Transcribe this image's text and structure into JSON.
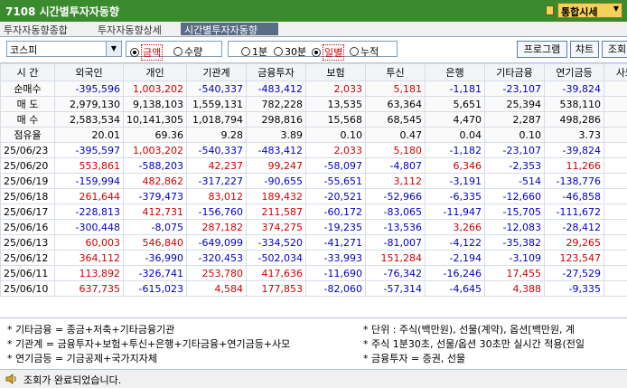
{
  "window": {
    "title": "7108 시간별투자자동향",
    "combo": "통합시세"
  },
  "tabs": [
    {
      "label": "투자자동향종합"
    },
    {
      "label": "투자자동향상세"
    },
    {
      "label": "시간별투자자동향"
    }
  ],
  "toolbar": {
    "market": "코스피",
    "unit": [
      {
        "label": "금액",
        "selected": true
      },
      {
        "label": "수량",
        "selected": false
      }
    ],
    "period": [
      {
        "label": "1분",
        "selected": false
      },
      {
        "label": "30분",
        "selected": false
      },
      {
        "label": "일별",
        "selected": true
      },
      {
        "label": "누적",
        "selected": false
      }
    ],
    "buttons": [
      "프로그램",
      "챠트",
      "조회"
    ]
  },
  "table": {
    "headers": [
      "시  간",
      "외국인",
      "개인",
      "기관계",
      "금융투자",
      "보험",
      "투신",
      "은행",
      "기타금융",
      "연기금등",
      "사모펀"
    ],
    "summary": [
      {
        "label": "순매수",
        "values": [
          "-395,596",
          "1,003,202",
          "-540,337",
          "-483,412",
          "2,033",
          "5,181",
          "-1,181",
          "-23,107",
          "-39,824",
          ""
        ]
      },
      {
        "label": "매  도",
        "values": [
          "2,979,130",
          "9,138,103",
          "1,559,131",
          "782,228",
          "13,535",
          "63,364",
          "5,651",
          "25,394",
          "538,110",
          "130"
        ]
      },
      {
        "label": "매  수",
        "values": [
          "2,583,534",
          "10,141,305",
          "1,018,794",
          "298,816",
          "15,568",
          "68,545",
          "4,470",
          "2,287",
          "498,286",
          "130"
        ]
      },
      {
        "label": "점유율",
        "values": [
          "20.01",
          "69.36",
          "9.28",
          "3.89",
          "0.10",
          "0.47",
          "0.04",
          "0.10",
          "3.73",
          ""
        ]
      }
    ],
    "rows": [
      {
        "date": "25/06/23",
        "values": [
          "-395,597",
          "1,003,202",
          "-540,337",
          "-483,412",
          "2,033",
          "5,180",
          "-1,182",
          "-23,107",
          "-39,824",
          ""
        ]
      },
      {
        "date": "25/06/20",
        "values": [
          "553,861",
          "-588,203",
          "42,237",
          "99,247",
          "-58,097",
          "-4,807",
          "6,346",
          "-2,353",
          "11,266",
          "-9"
        ]
      },
      {
        "date": "25/06/19",
        "values": [
          "-159,994",
          "482,862",
          "-317,227",
          "-90,655",
          "-55,651",
          "3,112",
          "-3,191",
          "-514",
          "-138,776",
          "-31"
        ]
      },
      {
        "date": "25/06/18",
        "values": [
          "261,644",
          "-379,473",
          "83,012",
          "189,432",
          "-20,521",
          "-52,966",
          "-6,335",
          "-12,660",
          "-46,858",
          "32"
        ]
      },
      {
        "date": "25/06/17",
        "values": [
          "-228,813",
          "412,731",
          "-156,760",
          "211,587",
          "-60,172",
          "-83,065",
          "-11,947",
          "-15,705",
          "-111,672",
          "-85"
        ]
      },
      {
        "date": "25/06/16",
        "values": [
          "-300,448",
          "-8,075",
          "287,182",
          "374,275",
          "-19,235",
          "-13,536",
          "3,266",
          "-12,083",
          "-28,412",
          "-17"
        ]
      },
      {
        "date": "25/06/13",
        "values": [
          "60,003",
          "546,840",
          "-649,099",
          "-334,520",
          "-41,271",
          "-81,007",
          "-4,122",
          "-35,382",
          "29,265",
          "-182"
        ]
      },
      {
        "date": "25/06/12",
        "values": [
          "364,112",
          "-36,990",
          "-320,453",
          "-502,034",
          "-33,993",
          "151,284",
          "-2,194",
          "-3,109",
          "123,547",
          "-53"
        ]
      },
      {
        "date": "25/06/11",
        "values": [
          "113,892",
          "-326,741",
          "253,780",
          "417,636",
          "-11,690",
          "-76,342",
          "-16,246",
          "17,455",
          "-27,529",
          "-49"
        ]
      },
      {
        "date": "25/06/10",
        "values": [
          "637,735",
          "-615,023",
          "4,584",
          "177,853",
          "-82,060",
          "-57,314",
          "-4,645",
          "4,388",
          "-9,335",
          "-24"
        ]
      }
    ]
  },
  "notes": {
    "left": [
      "* 기타금융 = 종금+저축+기타금융기관",
      "* 기관계 = 금융투자+보험+투신+은행+기타금융+연기금등+사모",
      "* 연기금등 = 기금공제+국가지자체"
    ],
    "right": [
      "* 단위 : 주식(백만원), 선물(계약), 옵션[백만원, 계",
      "* 주식 1분30초, 선물/옵션 30초만 실시간 적용(전일",
      "* 금융투자 = 증권, 선물"
    ]
  },
  "status": {
    "message": "조회가 완료되었습니다."
  },
  "colors": {
    "title_bg": "#3a8a2e",
    "positive": "#d00000",
    "negative": "#0000c8"
  }
}
